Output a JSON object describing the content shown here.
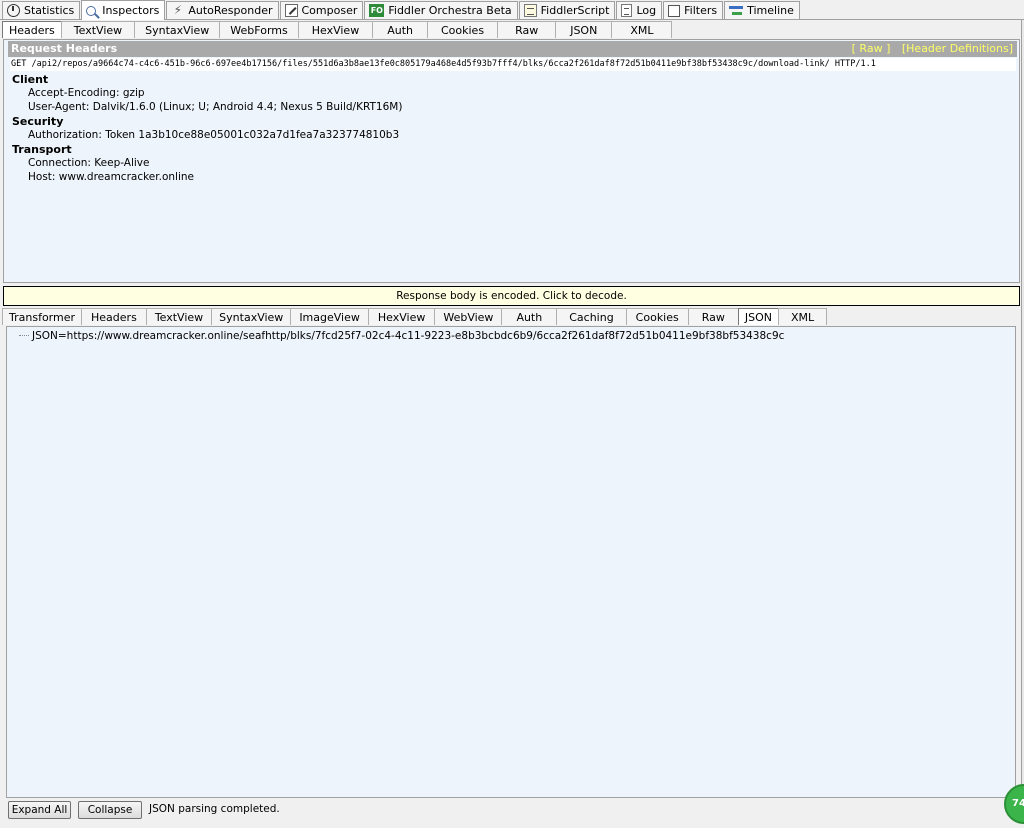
{
  "main_tabs": [
    {
      "label": "Statistics",
      "icon": "stopwatch-icon"
    },
    {
      "label": "Inspectors",
      "icon": "magnifier-icon"
    },
    {
      "label": "AutoResponder",
      "icon": "lightning-icon"
    },
    {
      "label": "Composer",
      "icon": "edit-icon"
    },
    {
      "label": "Fiddler Orchestra Beta",
      "icon": "fo-icon",
      "icon_text": "FO"
    },
    {
      "label": "FiddlerScript",
      "icon": "script-icon"
    },
    {
      "label": "Log",
      "icon": "log-icon"
    },
    {
      "label": "Filters",
      "icon": "checkbox-icon"
    },
    {
      "label": "Timeline",
      "icon": "timeline-icon"
    }
  ],
  "active_main_tab": "Inspectors",
  "request_tabs": [
    "Headers",
    "TextView",
    "SyntaxView",
    "WebForms",
    "HexView",
    "Auth",
    "Cookies",
    "Raw",
    "JSON",
    "XML"
  ],
  "active_request_tab": "Headers",
  "request": {
    "title": "Request Headers",
    "raw_link": "[ Raw ]",
    "defs_link": "[Header Definitions]",
    "request_line": "GET /api2/repos/a9664c74-c4c6-451b-96c6-697ee4b17156/files/551d6a3b8ae13fe0c805179a468e4d5f93b7fff4/blks/6cca2f261daf8f72d51b0411e9bf38bf53438c9c/download-link/ HTTP/1.1",
    "groups": [
      {
        "name": "Client",
        "items": [
          "Accept-Encoding: gzip",
          "User-Agent: Dalvik/1.6.0 (Linux; U; Android 4.4; Nexus 5 Build/KRT16M)"
        ]
      },
      {
        "name": "Security",
        "items": [
          "Authorization: Token 1a3b10ce88e05001c032a7d1fea7a323774810b3"
        ]
      },
      {
        "name": "Transport",
        "items": [
          "Connection: Keep-Alive",
          "Host: www.dreamcracker.online"
        ]
      }
    ]
  },
  "decode_message": "Response body is encoded. Click to decode.",
  "response_tabs": [
    "Transformer",
    "Headers",
    "TextView",
    "SyntaxView",
    "ImageView",
    "HexView",
    "WebView",
    "Auth",
    "Caching",
    "Cookies",
    "Raw",
    "JSON",
    "XML"
  ],
  "active_response_tab": "JSON",
  "json_tree": {
    "node": "JSON=https://www.dreamcracker.online/seafhttp/blks/7fcd25f7-02c4-4c11-9223-e8b3bcbdc6b9/6cca2f261daf8f72d51b0411e9bf38bf53438c9c"
  },
  "bottom": {
    "expand_label": "Expand All",
    "collapse_label": "Collapse",
    "status": "JSON parsing completed."
  },
  "badge_text": "74",
  "colors": {
    "panel_bg": "#eef4fb",
    "header_bar": "#a9a9a9",
    "header_links": "#ffff66",
    "decode_bg": "#ffffe1",
    "badge": "#3bb54a"
  }
}
